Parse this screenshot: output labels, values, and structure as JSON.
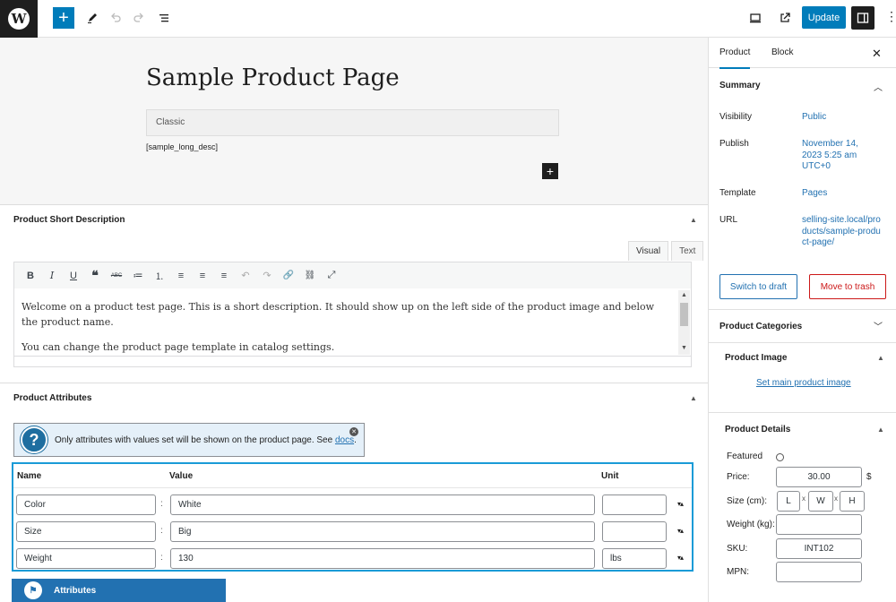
{
  "topbar": {
    "logo": "W",
    "add_icon": "+",
    "update_label": "Update"
  },
  "canvas": {
    "title": "Sample Product Page",
    "classic_label": "Classic",
    "shortcode": "[sample_long_desc]",
    "add_block_icon": "+"
  },
  "short_description": {
    "title": "Product Short Description",
    "tabs": {
      "visual": "Visual",
      "text": "Text"
    },
    "toolbar": [
      "B",
      "I",
      "U",
      "❝",
      "ABC",
      "≔",
      "⒈",
      "≡",
      "≡",
      "≡",
      "↶",
      "↷",
      "🔗",
      "⛓",
      "⤢"
    ],
    "paragraphs": [
      "Welcome on a product test page. This is a short description. It should show up on the left side of the product image and below the product name.",
      "You can change the product page template in catalog settings."
    ]
  },
  "attributes": {
    "title": "Product Attributes",
    "notice": "Only attributes with values set will be shown on the product page. See ",
    "notice_link": "docs",
    "notice_end": ".",
    "headers": {
      "name": "Name",
      "value": "Value",
      "unit": "Unit"
    },
    "rows": [
      {
        "name": "Color",
        "value": "White",
        "unit": ""
      },
      {
        "name": "Size",
        "value": "Big",
        "unit": ""
      },
      {
        "name": "Weight",
        "value": "130",
        "unit": "lbs"
      }
    ],
    "footer": "Attributes"
  },
  "sidebar": {
    "tab_product": "Product",
    "tab_block": "Block",
    "summary_title": "Summary",
    "visibility_label": "Visibility",
    "visibility_value": "Public",
    "publish_label": "Publish",
    "publish_value": "November 14, 2023 5:25 am UTC+0",
    "template_label": "Template",
    "template_value": "Pages",
    "url_label": "URL",
    "url_value": "selling-site.local/products/sample-product-page/",
    "switch_draft": "Switch to draft",
    "move_trash": "Move to trash",
    "categories_title": "Product Categories",
    "image_title": "Product Image",
    "set_image": "Set main product image",
    "details_title": "Product Details",
    "featured_label": "Featured",
    "price_label": "Price:",
    "price_value": "30.00",
    "currency": "$",
    "size_label": "Size (cm):",
    "size_l": "L",
    "size_w": "W",
    "size_h": "H",
    "size_x": "x",
    "weight_label": "Weight (kg):",
    "weight_value": "",
    "sku_label": "SKU:",
    "sku_value": "INT102",
    "mpn_label": "MPN:",
    "mpn_value": ""
  }
}
